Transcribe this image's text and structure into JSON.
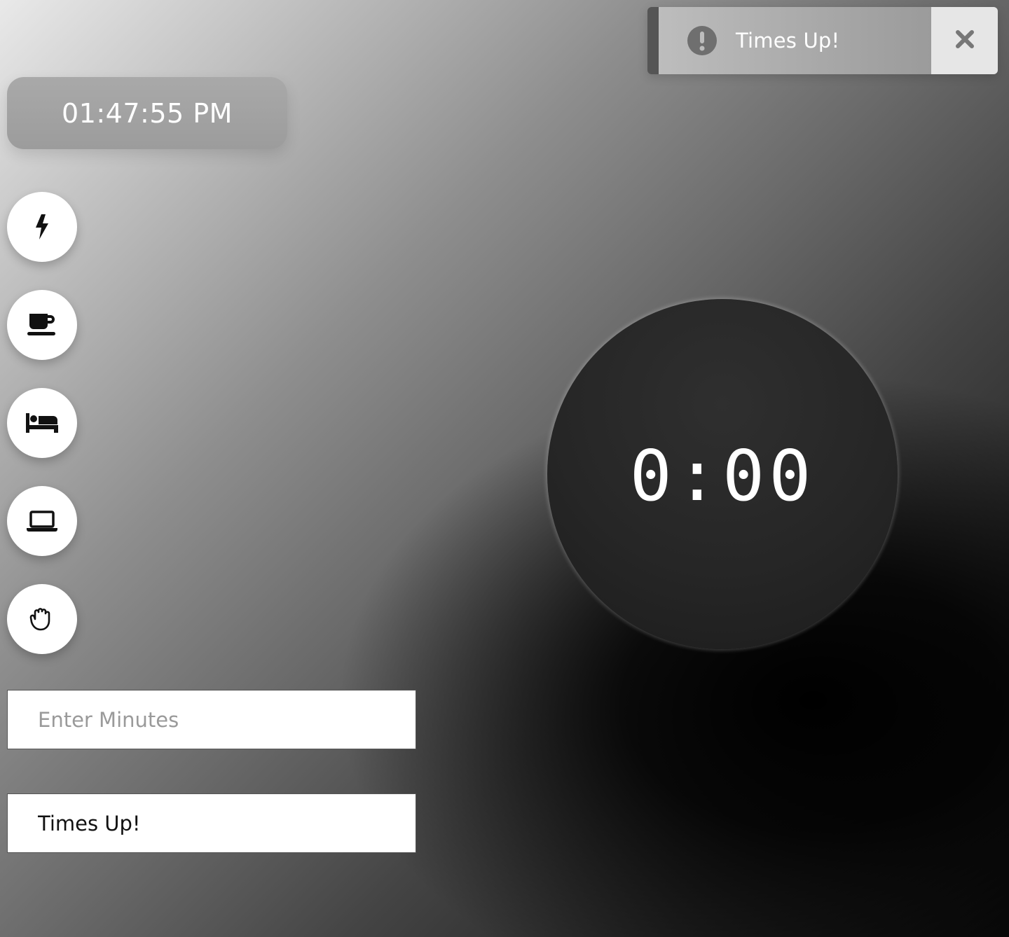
{
  "toast": {
    "message": "Times Up!",
    "icon": "exclamation-circle-icon",
    "close_icon": "close-icon",
    "colors": {
      "stripe": "#555555",
      "body": "#a8a8a8",
      "close_bg": "#e6e6e6",
      "text": "#ffffff"
    }
  },
  "clock": {
    "time": "01:47:55 PM"
  },
  "modes": [
    {
      "name": "focus",
      "icon": "bolt-icon"
    },
    {
      "name": "break",
      "icon": "coffee-icon"
    },
    {
      "name": "rest",
      "icon": "bed-icon"
    },
    {
      "name": "work",
      "icon": "laptop-icon"
    },
    {
      "name": "stop",
      "icon": "hand-icon"
    }
  ],
  "timer": {
    "display": "0:00"
  },
  "inputs": {
    "minutes": {
      "placeholder": "Enter Minutes",
      "value": ""
    },
    "message": {
      "placeholder": "",
      "value": "Times Up!"
    }
  }
}
